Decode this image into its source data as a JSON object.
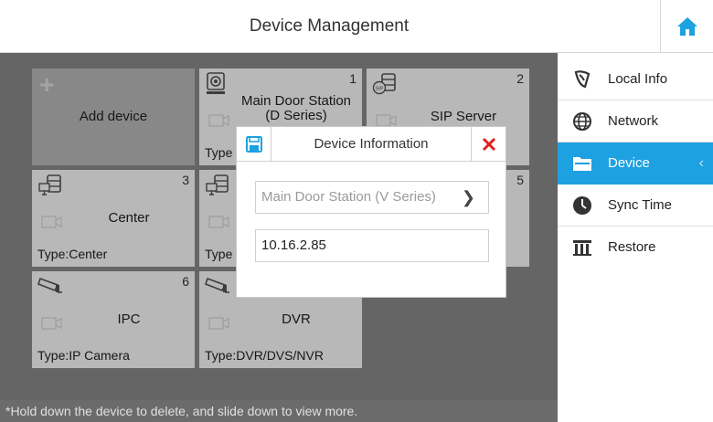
{
  "header": {
    "title": "Device Management",
    "home_icon": "home-icon"
  },
  "colors": {
    "accent": "#1ea1e0",
    "close": "#e02020",
    "dim_overlay": "#8c8c8c"
  },
  "tiles": [
    {
      "name": "Add device"
    },
    {
      "num": "1",
      "name": "Main Door Station (D Series)",
      "type": "Type",
      "icon": "door-station-icon"
    },
    {
      "num": "2",
      "name": "SIP Server",
      "type": "",
      "icon": "sip-server-icon"
    },
    {
      "num": "3",
      "name": "Center",
      "type": "Type:Center",
      "icon": "server-icon"
    },
    {
      "num": "",
      "name": "",
      "type": "Type",
      "icon": "server-icon"
    },
    {
      "num": "5",
      "name": "",
      "type": "",
      "icon": ""
    },
    {
      "num": "6",
      "name": "IPC",
      "type": "Type:IP Camera",
      "icon": "ip-camera-icon"
    },
    {
      "num": "",
      "name": "DVR",
      "type": "Type:DVR/DVS/NVR",
      "icon": "ip-camera-icon"
    }
  ],
  "footer_note": "*Hold down the device to delete, and slide down to view more.",
  "dialog": {
    "title": "Device Information",
    "device_type": "Main Door Station (V Series)",
    "ip_address": "10.16.2.85"
  },
  "sidebar": {
    "items": [
      {
        "label": "Local Info",
        "icon": "local-info-icon"
      },
      {
        "label": "Network",
        "icon": "globe-icon"
      },
      {
        "label": "Device",
        "icon": "folder-icon",
        "active": true
      },
      {
        "label": "Sync Time",
        "icon": "clock-icon"
      },
      {
        "label": "Restore",
        "icon": "restore-icon"
      }
    ]
  }
}
